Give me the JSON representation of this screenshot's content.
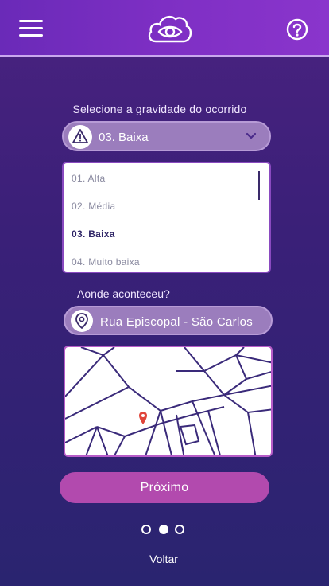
{
  "header": {
    "menu_icon": "hamburger-menu-icon",
    "logo_icon": "cloud-eye-logo-icon",
    "help_icon": "question-circle-icon"
  },
  "severity": {
    "label": "Selecione  a gravidade do ocorrido",
    "selected_value": "03. Baixa",
    "icon": "warning-triangle-icon",
    "options": [
      "01. Alta",
      "02. Média",
      "03. Baixa",
      "04. Muito baixa"
    ],
    "selected_index": 2
  },
  "location": {
    "label": "Aonde aconteceu?",
    "value": "Rua Episcopal - São Carlos",
    "icon": "map-pin-icon"
  },
  "map": {
    "marker_icon": "map-marker-icon"
  },
  "actions": {
    "next_label": "Próximo",
    "back_label": "Voltar"
  },
  "pagination": {
    "total": 3,
    "current": 2
  },
  "colors": {
    "accent_button": "#b24aae",
    "field_fill": "#9b7dbd",
    "marker": "#e0453a"
  }
}
